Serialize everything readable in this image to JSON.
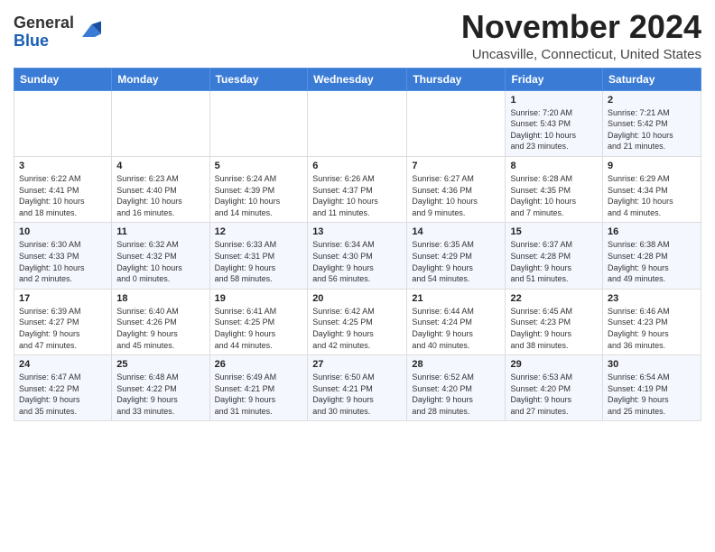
{
  "logo": {
    "general": "General",
    "blue": "Blue"
  },
  "title": "November 2024",
  "location": "Uncasville, Connecticut, United States",
  "weekdays": [
    "Sunday",
    "Monday",
    "Tuesday",
    "Wednesday",
    "Thursday",
    "Friday",
    "Saturday"
  ],
  "weeks": [
    [
      {
        "day": "",
        "info": ""
      },
      {
        "day": "",
        "info": ""
      },
      {
        "day": "",
        "info": ""
      },
      {
        "day": "",
        "info": ""
      },
      {
        "day": "",
        "info": ""
      },
      {
        "day": "1",
        "info": "Sunrise: 7:20 AM\nSunset: 5:43 PM\nDaylight: 10 hours\nand 23 minutes."
      },
      {
        "day": "2",
        "info": "Sunrise: 7:21 AM\nSunset: 5:42 PM\nDaylight: 10 hours\nand 21 minutes."
      }
    ],
    [
      {
        "day": "3",
        "info": "Sunrise: 6:22 AM\nSunset: 4:41 PM\nDaylight: 10 hours\nand 18 minutes."
      },
      {
        "day": "4",
        "info": "Sunrise: 6:23 AM\nSunset: 4:40 PM\nDaylight: 10 hours\nand 16 minutes."
      },
      {
        "day": "5",
        "info": "Sunrise: 6:24 AM\nSunset: 4:39 PM\nDaylight: 10 hours\nand 14 minutes."
      },
      {
        "day": "6",
        "info": "Sunrise: 6:26 AM\nSunset: 4:37 PM\nDaylight: 10 hours\nand 11 minutes."
      },
      {
        "day": "7",
        "info": "Sunrise: 6:27 AM\nSunset: 4:36 PM\nDaylight: 10 hours\nand 9 minutes."
      },
      {
        "day": "8",
        "info": "Sunrise: 6:28 AM\nSunset: 4:35 PM\nDaylight: 10 hours\nand 7 minutes."
      },
      {
        "day": "9",
        "info": "Sunrise: 6:29 AM\nSunset: 4:34 PM\nDaylight: 10 hours\nand 4 minutes."
      }
    ],
    [
      {
        "day": "10",
        "info": "Sunrise: 6:30 AM\nSunset: 4:33 PM\nDaylight: 10 hours\nand 2 minutes."
      },
      {
        "day": "11",
        "info": "Sunrise: 6:32 AM\nSunset: 4:32 PM\nDaylight: 10 hours\nand 0 minutes."
      },
      {
        "day": "12",
        "info": "Sunrise: 6:33 AM\nSunset: 4:31 PM\nDaylight: 9 hours\nand 58 minutes."
      },
      {
        "day": "13",
        "info": "Sunrise: 6:34 AM\nSunset: 4:30 PM\nDaylight: 9 hours\nand 56 minutes."
      },
      {
        "day": "14",
        "info": "Sunrise: 6:35 AM\nSunset: 4:29 PM\nDaylight: 9 hours\nand 54 minutes."
      },
      {
        "day": "15",
        "info": "Sunrise: 6:37 AM\nSunset: 4:28 PM\nDaylight: 9 hours\nand 51 minutes."
      },
      {
        "day": "16",
        "info": "Sunrise: 6:38 AM\nSunset: 4:28 PM\nDaylight: 9 hours\nand 49 minutes."
      }
    ],
    [
      {
        "day": "17",
        "info": "Sunrise: 6:39 AM\nSunset: 4:27 PM\nDaylight: 9 hours\nand 47 minutes."
      },
      {
        "day": "18",
        "info": "Sunrise: 6:40 AM\nSunset: 4:26 PM\nDaylight: 9 hours\nand 45 minutes."
      },
      {
        "day": "19",
        "info": "Sunrise: 6:41 AM\nSunset: 4:25 PM\nDaylight: 9 hours\nand 44 minutes."
      },
      {
        "day": "20",
        "info": "Sunrise: 6:42 AM\nSunset: 4:25 PM\nDaylight: 9 hours\nand 42 minutes."
      },
      {
        "day": "21",
        "info": "Sunrise: 6:44 AM\nSunset: 4:24 PM\nDaylight: 9 hours\nand 40 minutes."
      },
      {
        "day": "22",
        "info": "Sunrise: 6:45 AM\nSunset: 4:23 PM\nDaylight: 9 hours\nand 38 minutes."
      },
      {
        "day": "23",
        "info": "Sunrise: 6:46 AM\nSunset: 4:23 PM\nDaylight: 9 hours\nand 36 minutes."
      }
    ],
    [
      {
        "day": "24",
        "info": "Sunrise: 6:47 AM\nSunset: 4:22 PM\nDaylight: 9 hours\nand 35 minutes."
      },
      {
        "day": "25",
        "info": "Sunrise: 6:48 AM\nSunset: 4:22 PM\nDaylight: 9 hours\nand 33 minutes."
      },
      {
        "day": "26",
        "info": "Sunrise: 6:49 AM\nSunset: 4:21 PM\nDaylight: 9 hours\nand 31 minutes."
      },
      {
        "day": "27",
        "info": "Sunrise: 6:50 AM\nSunset: 4:21 PM\nDaylight: 9 hours\nand 30 minutes."
      },
      {
        "day": "28",
        "info": "Sunrise: 6:52 AM\nSunset: 4:20 PM\nDaylight: 9 hours\nand 28 minutes."
      },
      {
        "day": "29",
        "info": "Sunrise: 6:53 AM\nSunset: 4:20 PM\nDaylight: 9 hours\nand 27 minutes."
      },
      {
        "day": "30",
        "info": "Sunrise: 6:54 AM\nSunset: 4:19 PM\nDaylight: 9 hours\nand 25 minutes."
      }
    ]
  ]
}
